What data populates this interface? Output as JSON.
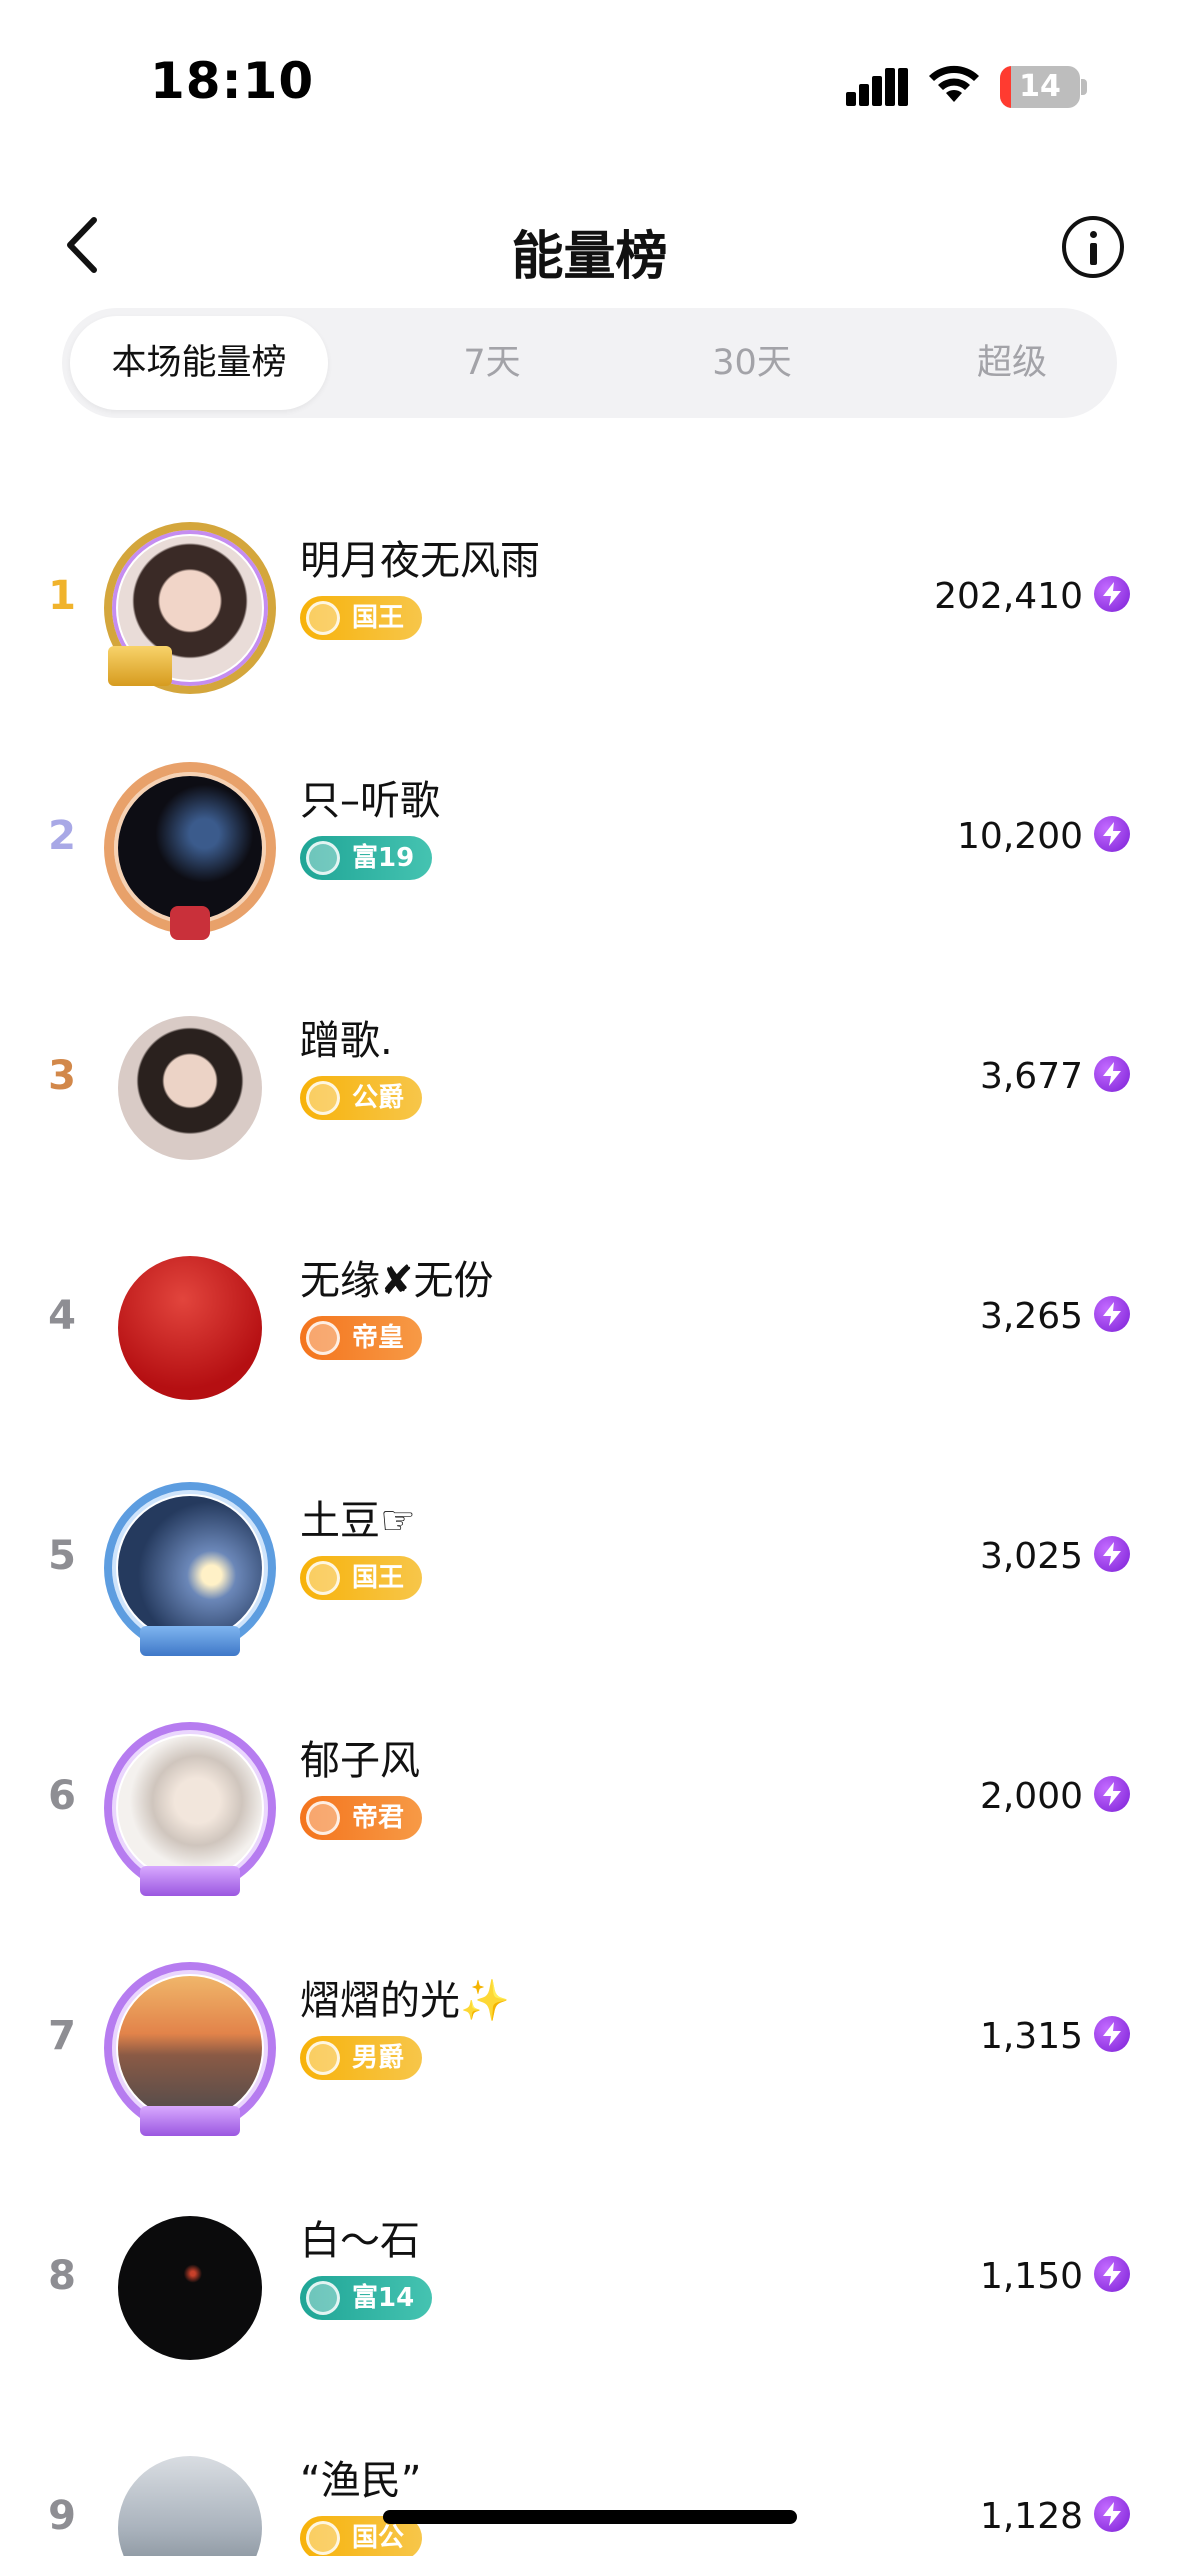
{
  "status_bar": {
    "time": "18:10",
    "battery": "14",
    "battery_level": 0.14,
    "battery_color": "#ff3b30"
  },
  "header": {
    "title": "能量榜"
  },
  "tabs": [
    {
      "label": "本场能量榜",
      "active": true
    },
    {
      "label": "7天",
      "active": false
    },
    {
      "label": "30天",
      "active": false
    },
    {
      "label": "超级",
      "active": false
    }
  ],
  "colors": {
    "gold": "#f0b32c",
    "silver": "#a8a8e6",
    "bronze": "#d2884a",
    "energy": "#8a2be2"
  },
  "rankings": [
    {
      "rank": "1",
      "name": "明月夜无风雨",
      "badge": "国王",
      "score": "202,410"
    },
    {
      "rank": "2",
      "name": "只–听歌",
      "badge": "富19",
      "score": "10,200"
    },
    {
      "rank": "3",
      "name": "蹭歌.",
      "badge": "公爵",
      "score": "3,677"
    },
    {
      "rank": "4",
      "name": "无缘✘无份",
      "badge": "帝皇",
      "score": "3,265"
    },
    {
      "rank": "5",
      "name": "土豆☞",
      "badge": "国王",
      "score": "3,025"
    },
    {
      "rank": "6",
      "name": "郁子风",
      "badge": "帝君",
      "score": "2,000"
    },
    {
      "rank": "7",
      "name": "熠熠的光✨",
      "badge": "男爵",
      "score": "1,315"
    },
    {
      "rank": "8",
      "name": "白～石",
      "badge": "富14",
      "score": "1,150"
    },
    {
      "rank": "9",
      "name": "“渔民”",
      "badge": "国公",
      "score": "1,128"
    }
  ]
}
